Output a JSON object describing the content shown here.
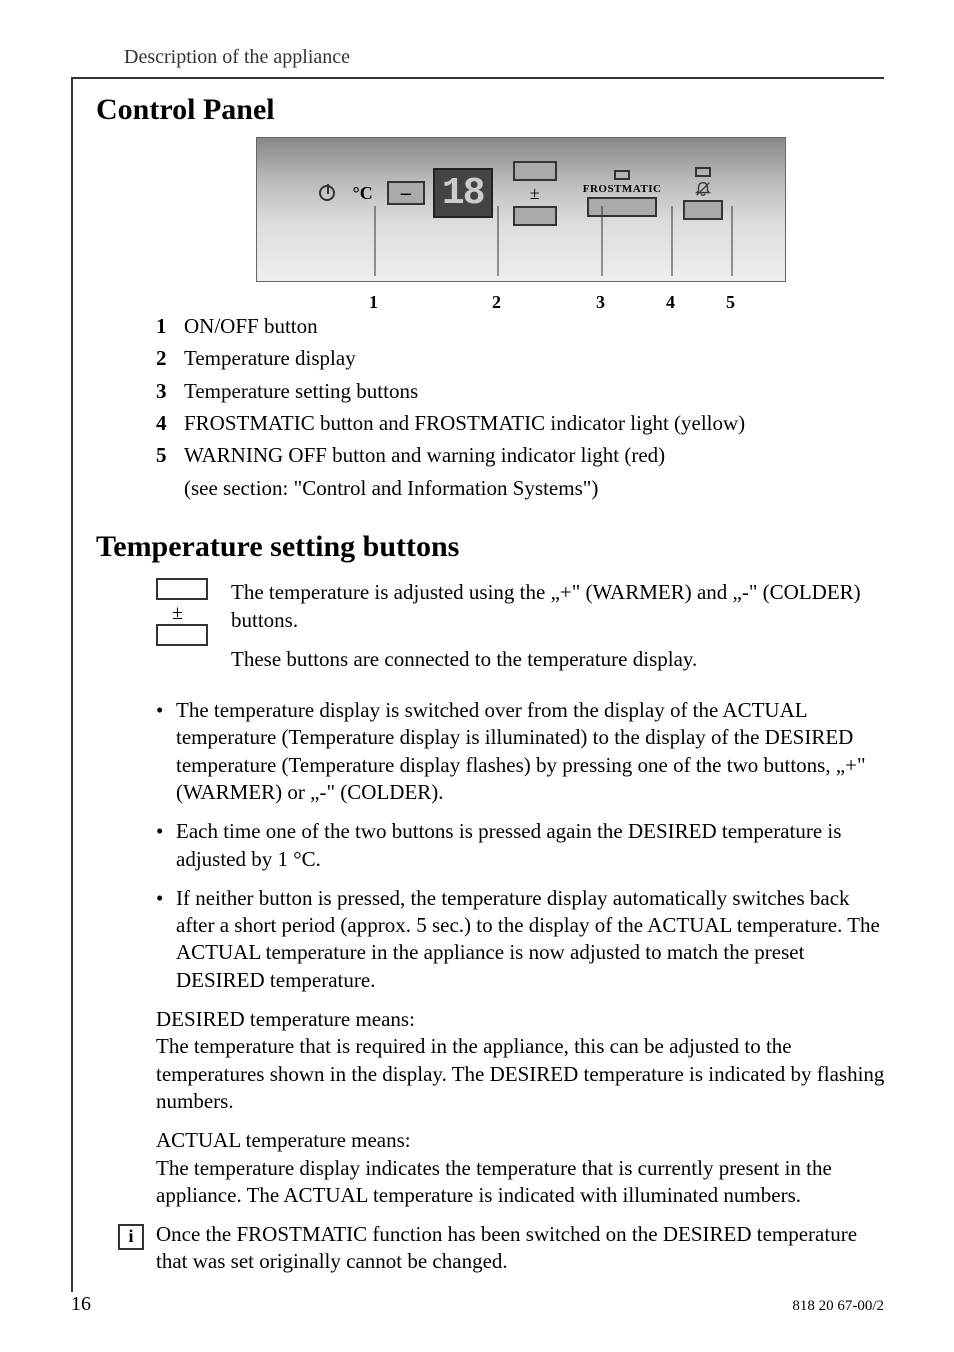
{
  "header": "Description of the appliance",
  "section1_title": "Control Panel",
  "panel": {
    "celsius": "°C",
    "display": "18",
    "frostmatic": "FROSTMATIC",
    "callouts": [
      "1",
      "2",
      "3",
      "4",
      "5"
    ]
  },
  "legend": [
    {
      "num": "1",
      "text": "ON/OFF button"
    },
    {
      "num": "2",
      "text": "Temperature display"
    },
    {
      "num": "3",
      "text": "Temperature setting buttons"
    },
    {
      "num": "4",
      "text": "FROSTMATIC button and FROSTMATIC indicator light (yellow)"
    },
    {
      "num": "5",
      "text": "WARNING OFF button and warning indicator light (red)"
    }
  ],
  "legend_sub": "(see section: \"Control and Information Systems\")",
  "section2_title": "Temperature setting buttons",
  "intro_para1": "The temperature is adjusted using the „+\" (WARMER) and „-\" (COLDER) buttons.",
  "intro_para2": "These buttons are connected to the temperature display.",
  "pm_symbol": "±",
  "bullets": [
    "The temperature display is switched over from the display of the ACTUAL temperature (Temperature display is illuminated) to the display of the DESIRED temperature (Temperature display flashes) by pressing one of the two buttons, „+\" (WARMER) or „-\" (COLDER).",
    "Each time one of the two buttons is pressed again the DESIRED temperature is adjusted by 1 °C.",
    "If neither button is pressed, the temperature display automatically switches back after a short period (approx. 5 sec.) to the display of the ACTUAL temperature. The ACTUAL temperature in the appliance is now adjusted to match the preset DESIRED temperature."
  ],
  "desired_heading": "DESIRED temperature means:",
  "desired_text": "The temperature that is required in the appliance, this can be adjusted to the temperatures shown in the display. The DESIRED temperature is indicated by flashing numbers.",
  "actual_heading": "ACTUAL temperature means:",
  "actual_text": "The temperature display indicates the temperature that is currently present in the appliance. The ACTUAL temperature is indicated with illuminated numbers.",
  "info_symbol": "i",
  "info_text": "Once the FROSTMATIC function has been switched on the DESIRED temperature that was set originally cannot be changed.",
  "page_number": "16",
  "doc_id": "818 20 67-00/2"
}
